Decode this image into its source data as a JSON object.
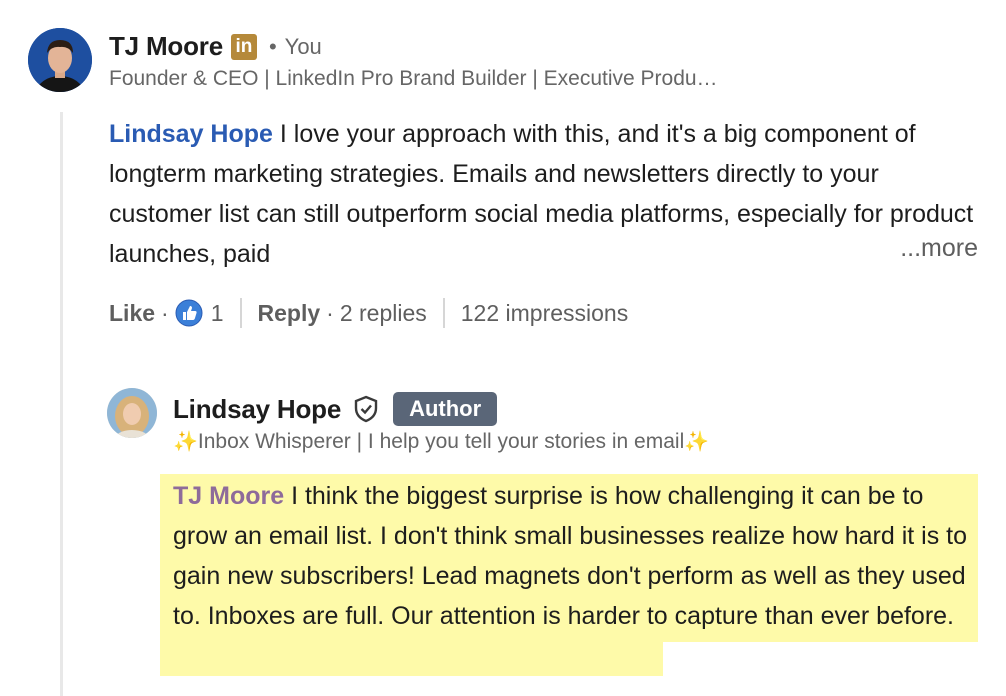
{
  "comment": {
    "author": {
      "name": "TJ Moore",
      "badge_text": "in",
      "relation": "You",
      "headline": "Founder & CEO | LinkedIn Pro Brand Builder | Executive Produ…",
      "avatar_icon": "avatar-photo"
    },
    "mention": "Lindsay Hope",
    "text": " I love your approach with this, and it's a big component of longterm marketing strategies. Emails and newsletters directly to your customer list can still outperform social media platforms, especially for product launches, paid",
    "more_label": "...more",
    "actions": {
      "like_label": "Like",
      "reaction_icon": "thumbs-up-icon",
      "reaction_count": "1",
      "reply_label": "Reply",
      "replies_text": "2 replies",
      "impressions_text": "122 impressions"
    }
  },
  "reply": {
    "author": {
      "name": "Lindsay Hope",
      "verified_icon": "shield-check-icon",
      "author_badge": "Author",
      "headline_prefix": "✨",
      "headline": "Inbox Whisperer | I help you tell your stories in email ",
      "headline_suffix": "✨",
      "avatar_icon": "avatar-photo"
    },
    "mention": "TJ Moore",
    "text": " I think the biggest surprise is how challenging it can be to grow an email list. I don't think small businesses realize how hard it is to gain new subscribers! Lead magnets don't perform as well as they used to. Inboxes are full. Our attention is harder to capture than ever before."
  },
  "colors": {
    "mention_blue": "#2a5bb3",
    "mention_purple": "#8e6b9a",
    "highlight": "#fefaa9",
    "author_badge": "#5a6678",
    "linkedin_badge": "#b5893a"
  }
}
